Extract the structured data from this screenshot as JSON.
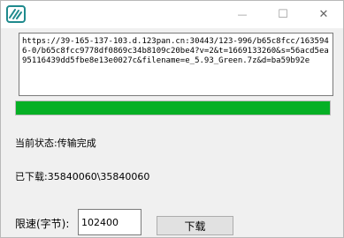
{
  "window": {
    "icon": "app-icon",
    "controls": {
      "minimize": "—",
      "maximize": "☐",
      "close": "✕"
    }
  },
  "url": "https://39-165-137-103.d.123pan.cn:30443/123-996/b65c8fcc/1635946-0/b65c8fcc9778df0869c34b8109c20be4?v=2&t=1669133260&s=56acd5ea95116439dd5fbe8e13e0027c&filename=e_5.93_Green.7z&d=ba59b92e",
  "progress": {
    "percent": 100,
    "color": "#06b025"
  },
  "status": {
    "text": "当前状态:传输完成"
  },
  "downloaded": {
    "text": "已下载:35840060\\35840060"
  },
  "speed": {
    "label": "限速(字节):",
    "value": "102400"
  },
  "buttons": {
    "download": "下载"
  }
}
